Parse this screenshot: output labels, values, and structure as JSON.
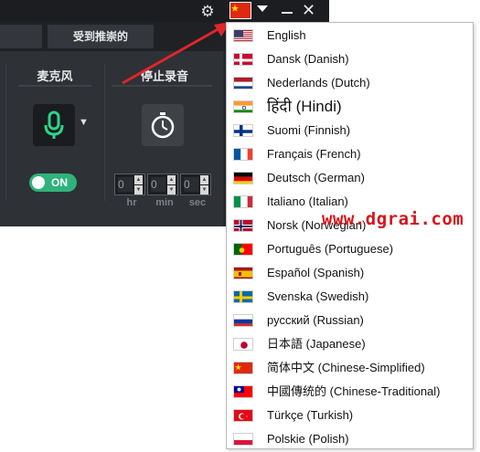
{
  "tabs": {
    "received": "受到推崇的"
  },
  "sections": {
    "microphone": "麦克风",
    "stop_recording": "停止录音"
  },
  "toggle": {
    "label": "ON",
    "state": "on"
  },
  "stop_timer": {
    "hours": "0",
    "minutes": "0",
    "seconds": "0",
    "units": {
      "hr": "hr",
      "min": "min",
      "sec": "sec"
    }
  },
  "title_bar": {
    "current_language_flag": "cn",
    "icons": [
      "gear-icon",
      "flag-icon",
      "caret-down-icon",
      "minimize-icon",
      "close-icon"
    ]
  },
  "language_menu": [
    {
      "label": "English",
      "flag": "us"
    },
    {
      "label": "Dansk (Danish)",
      "flag": "dk"
    },
    {
      "label": "Nederlands (Dutch)",
      "flag": "nl"
    },
    {
      "label": "हिंदी (Hindi)",
      "flag": "in"
    },
    {
      "label": "Suomi (Finnish)",
      "flag": "fi"
    },
    {
      "label": "Français (French)",
      "flag": "fr"
    },
    {
      "label": "Deutsch (German)",
      "flag": "de"
    },
    {
      "label": "Italiano (Italian)",
      "flag": "it"
    },
    {
      "label": "Norsk (Norwegian)",
      "flag": "no"
    },
    {
      "label": "Português (Portuguese)",
      "flag": "pt"
    },
    {
      "label": "Español (Spanish)",
      "flag": "es"
    },
    {
      "label": "Svenska (Swedish)",
      "flag": "se"
    },
    {
      "label": "русский (Russian)",
      "flag": "ru"
    },
    {
      "label": "日本語 (Japanese)",
      "flag": "jp"
    },
    {
      "label": "简体中文 (Chinese-Simplified)",
      "flag": "cn"
    },
    {
      "label": "中國傳统的 (Chinese-Traditional)",
      "flag": "tw"
    },
    {
      "label": "Türkçe (Turkish)",
      "flag": "tr"
    },
    {
      "label": "Polskie (Polish)",
      "flag": "pl"
    }
  ],
  "watermark": "www.dgrai.com",
  "colors": {
    "accent_green": "#2fb37a",
    "arrow_red": "#e0262b",
    "dark_bg": "#2b2e33"
  }
}
